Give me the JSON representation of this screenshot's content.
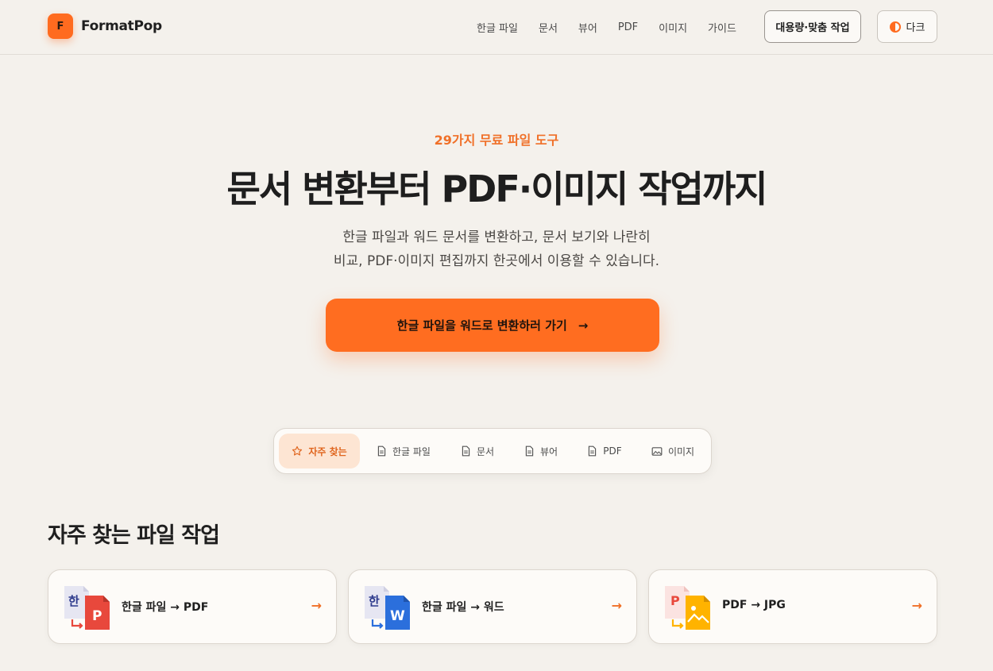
{
  "brand": {
    "logo_letter": "F",
    "name": "FormatPop",
    "accent": "#ff6b1f"
  },
  "nav": {
    "items": [
      "한글 파일",
      "문서",
      "뷰어",
      "PDF",
      "이미지",
      "가이드"
    ],
    "bulk_button": "대용량·맞춤 작업",
    "theme_button": "다크"
  },
  "hero": {
    "eyebrow": "29가지 무료 파일 도구",
    "title": "문서 변환부터 PDF·이미지 작업까지",
    "desc_line1": "한글 파일과 워드 문서를 변환하고, 문서 보기와 나란히",
    "desc_line2": "비교, PDF·이미지 편집까지 한곳에서 이용할 수 있습니다.",
    "cta_label": "한글 파일을 워드로 변환하러 가기",
    "cta_arrow": "→"
  },
  "tabs": [
    {
      "label": "자주 찾는",
      "icon": "star-icon",
      "active": true
    },
    {
      "label": "한글 파일",
      "icon": "document-icon",
      "active": false
    },
    {
      "label": "문서",
      "icon": "document-icon",
      "active": false
    },
    {
      "label": "뷰어",
      "icon": "document-icon",
      "active": false
    },
    {
      "label": "PDF",
      "icon": "document-icon",
      "active": false
    },
    {
      "label": "이미지",
      "icon": "image-icon",
      "active": false
    }
  ],
  "section": {
    "title": "자주 찾는 파일 작업",
    "cards": [
      {
        "label": "한글 파일 → PDF",
        "from_glyph": "한",
        "to_glyph": "P",
        "from_color": "#2d3a8c",
        "to_color": "#e8483c",
        "arrow": "→"
      },
      {
        "label": "한글 파일 → 워드",
        "from_glyph": "한",
        "to_glyph": "W",
        "from_color": "#2d3a8c",
        "to_color": "#2b6fdc",
        "arrow": "→"
      },
      {
        "label": "PDF → JPG",
        "from_glyph": "P",
        "to_glyph": "",
        "from_color": "#e8483c",
        "to_color": "#ffb300",
        "arrow": "→"
      }
    ]
  }
}
